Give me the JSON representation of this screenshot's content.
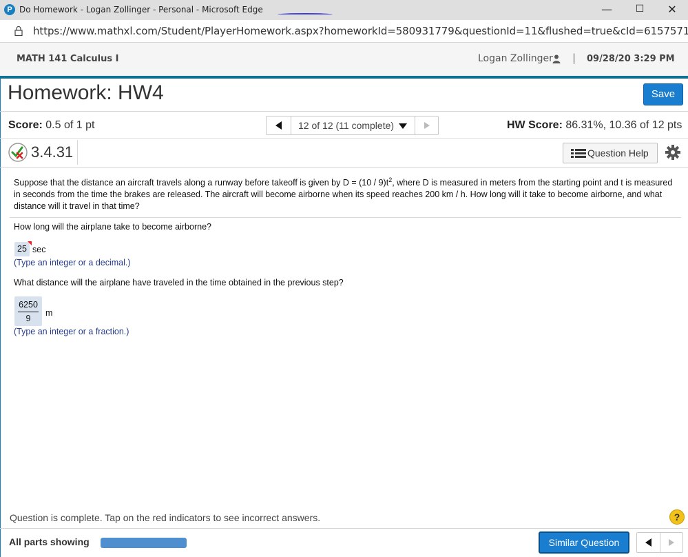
{
  "window": {
    "title": "Do Homework - Logan Zollinger - Personal - Microsoft Edge",
    "app_icon_letter": "P",
    "minimize": "—",
    "maximize": "☐",
    "close": "✕"
  },
  "address": {
    "url": "https://www.mathxl.com/Student/PlayerHomework.aspx?homeworkId=580931779&questionId=11&flushed=true&cId=6157571&..."
  },
  "course": {
    "name": "MATH 141 Calculus I",
    "user": "Logan Zollinger",
    "separator": "|",
    "datetime": "09/28/20 3:29 PM"
  },
  "homework": {
    "title": "Homework: HW4",
    "save_label": "Save"
  },
  "score": {
    "label": "Score:",
    "value": "0.5 of 1 pt",
    "nav_selected": "12 of 12 (11 complete)",
    "hw_label": "HW Score:",
    "hw_value": "86.31%, 10.36 of 12 pts"
  },
  "question": {
    "number": "3.4.31",
    "help_label": "Question Help",
    "status_icon": "partial-correct-icon",
    "text_part1": "Suppose that the distance an aircraft travels along a runway before takeoff is given by D = (10 / 9)t",
    "text_sup": "2",
    "text_part2": ", where D is measured in meters from the starting point and t is measured in seconds from the time the brakes are released. The aircraft will become airborne when its speed reaches 200 km / h. How long will it take to become airborne, and what distance will it travel in that time?",
    "part1_prompt": "How long will the airplane take to become airborne?",
    "part1_answer": "25",
    "part1_unit": "sec",
    "part1_hint": "(Type an integer or a decimal.)",
    "part2_prompt": "What distance will the airplane have traveled in the time obtained in the previous step?",
    "part2_numerator": "6250",
    "part2_denominator": "9",
    "part2_unit": "m",
    "part2_hint": "(Type an integer or a fraction.)"
  },
  "footer": {
    "complete_message": "Question is complete. Tap on the red indicators to see incorrect answers.",
    "help_symbol": "?",
    "parts_label": "All parts showing",
    "parts_progress": 1.0,
    "similar_label": "Similar Question"
  },
  "colors": {
    "accent_blue": "#1a7ed0",
    "teal_rule": "#10708f",
    "answer_bg": "#d7e2ee",
    "hint_text": "#253b8c",
    "incorrect_flag": "#e22222"
  }
}
